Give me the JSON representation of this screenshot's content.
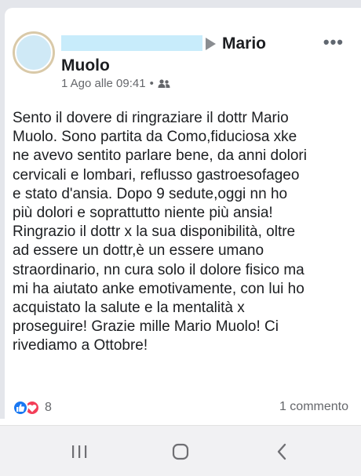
{
  "post": {
    "author_name": "Mario Muolo",
    "author_first": "Mario",
    "author_last": "Muolo",
    "timestamp": "1 Ago alle 09:41",
    "separator": "•",
    "audience_icon": "friends-icon",
    "more_label": "•••",
    "text": "Sento il dovere di ringraziare il dottr Mario\nMuolo. Sono partita da Como,fiduciosa xke\nne avevo sentito parlare bene, da anni dolori\ncervicali e lombari, reflusso gastroesofageo\ne stato d'ansia. Dopo 9 sedute,oggi nn ho\npiù dolori e soprattutto niente più ansia!\nRingrazio il dottr x la sua disponibilità, oltre\nad essere un dottr,è un essere umano\nstraordinario, nn cura solo il dolore fisico ma\nmi ha aiutato anke emotivamente, con lui ho\nacquistato la salute e la mentalità x\nproseguire! Grazie mille Mario Muolo! Ci\nrivediamo a Ottobre!",
    "reactions": {
      "icons": [
        "like-icon",
        "love-icon"
      ],
      "count": "8"
    },
    "comments_label": "1 commento"
  },
  "navbar": {
    "items": [
      "recent-apps-icon",
      "home-icon",
      "back-icon"
    ]
  },
  "colors": {
    "like": "#1877f2",
    "love": "#f33e58",
    "secondary_text": "#65676b",
    "redacted_name": "#c8ecfb",
    "avatar_fill": "#cfe9f6"
  }
}
